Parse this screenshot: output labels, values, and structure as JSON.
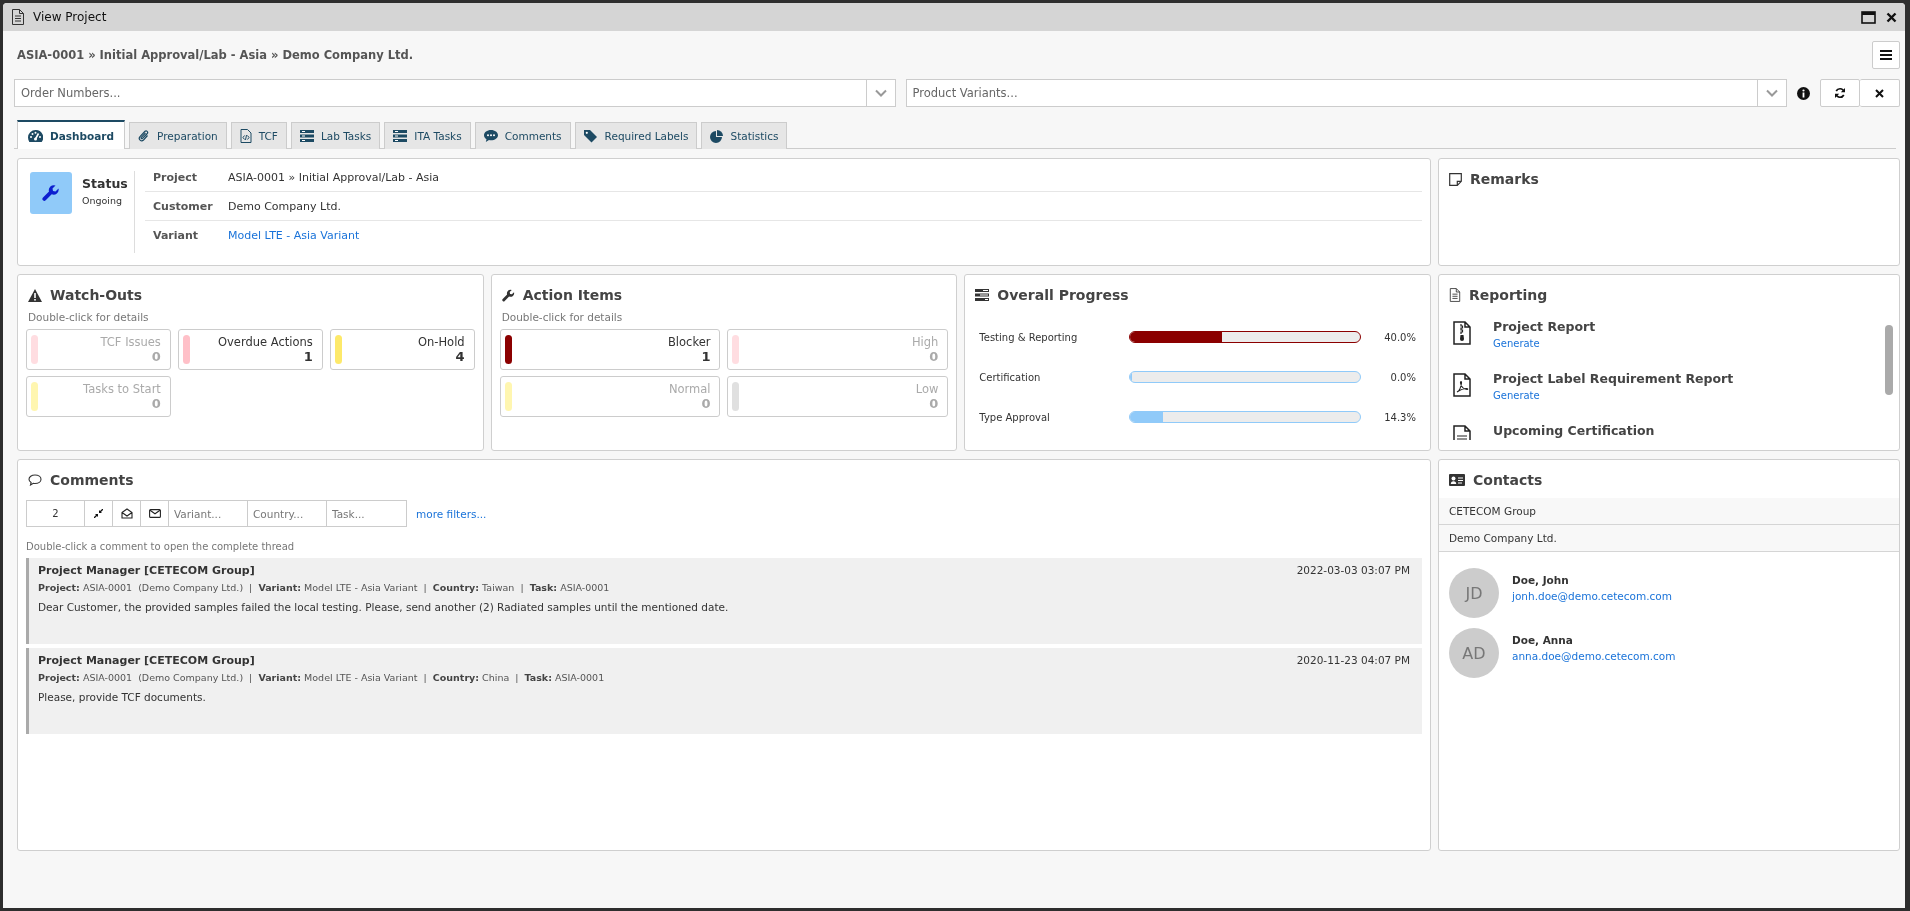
{
  "window": {
    "title": "View Project"
  },
  "breadcrumb": "ASIA-0001 » Initial Approval/Lab - Asia » Demo Company Ltd.",
  "filters": {
    "order_numbers": {
      "placeholder": "Order Numbers..."
    },
    "product_variants": {
      "placeholder": "Product Variants..."
    }
  },
  "tabs": [
    {
      "label": "Dashboard",
      "kind": "dashboard",
      "selected": true
    },
    {
      "label": "Preparation",
      "kind": "paperclip",
      "selected": false
    },
    {
      "label": "TCF",
      "kind": "code-file",
      "selected": false
    },
    {
      "label": "Lab Tasks",
      "kind": "tasks",
      "selected": false
    },
    {
      "label": "ITA Tasks",
      "kind": "tasks",
      "selected": false
    },
    {
      "label": "Comments",
      "kind": "chat",
      "selected": false
    },
    {
      "label": "Required Labels",
      "kind": "tags",
      "selected": false
    },
    {
      "label": "Statistics",
      "kind": "pie",
      "selected": false
    }
  ],
  "status": {
    "label": "Status",
    "value": "Ongoing",
    "rows": [
      {
        "label": "Project",
        "value": "ASIA-0001 » Initial Approval/Lab - Asia",
        "kind": "text"
      },
      {
        "label": "Customer",
        "value": "Demo Company Ltd.",
        "kind": "text"
      },
      {
        "label": "Variant",
        "value": "Model LTE - Asia Variant",
        "kind": "link"
      }
    ]
  },
  "remarks": {
    "title": "Remarks"
  },
  "watch_outs": {
    "title": "Watch-Outs",
    "hint": "Double-click for details",
    "tiles": [
      {
        "label": "TCF Issues",
        "count": "0",
        "color": "#ffdde1",
        "active": false
      },
      {
        "label": "Overdue Actions",
        "count": "1",
        "color": "#ffc0c8",
        "active": true
      },
      {
        "label": "On-Hold",
        "count": "4",
        "color": "#fde96a",
        "active": true
      },
      {
        "label": "Tasks to Start",
        "count": "0",
        "color": "#fff6b0",
        "active": false
      }
    ]
  },
  "action_items": {
    "title": "Action Items",
    "hint": "Double-click for details",
    "tiles": [
      {
        "label": "Blocker",
        "count": "1",
        "color": "#8b0000",
        "active": true
      },
      {
        "label": "High",
        "count": "0",
        "color": "#ffdde1",
        "active": false
      },
      {
        "label": "Normal",
        "count": "0",
        "color": "#fff6b0",
        "active": false
      },
      {
        "label": "Low",
        "count": "0",
        "color": "#e0e0e0",
        "active": false
      }
    ]
  },
  "overall_progress": {
    "title": "Overall Progress",
    "items": [
      {
        "label": "Testing & Reporting",
        "level": 0.4,
        "reading": "40.0%",
        "color": "#8b0000"
      },
      {
        "label": "Certification",
        "level": 0,
        "reading": "0.0%",
        "color": "#90caf9"
      },
      {
        "label": "Type Approval",
        "level": 0.143,
        "reading": "14.3%",
        "color": "#90caf9"
      }
    ]
  },
  "reporting": {
    "title": "Reporting",
    "items": [
      {
        "kind": "zip",
        "title": "Project Report",
        "action": "Generate"
      },
      {
        "kind": "pdf",
        "title": "Project Label Requirement Report",
        "action": "Generate"
      },
      {
        "kind": "doc",
        "title": "Upcoming Certification"
      }
    ]
  },
  "comments": {
    "title": "Comments",
    "filter": {
      "count": "2",
      "variant": {
        "placeholder": "Variant..."
      },
      "country": {
        "placeholder": "Country..."
      },
      "task": {
        "placeholder": "Task..."
      },
      "more": "more filters..."
    },
    "hint": "Double-click a comment to open the complete thread",
    "items": [
      {
        "author": "Project Manager [CETECOM Group]",
        "date": "2022-03-03 03:07 PM",
        "meta": "**Project:** ASIA-0001  (Demo Company Ltd.)  |  **Variant:** Model LTE - Asia Variant  |  **Country:** Taiwan  |  **Task:** ASIA-0001",
        "text": "Dear Customer, the provided samples failed the local testing. Please, send another (2) Radiated samples until the mentioned date."
      },
      {
        "author": "Project Manager [CETECOM Group]",
        "date": "2020-11-23 04:07 PM",
        "meta": "**Project:** ASIA-0001  (Demo Company Ltd.)  |  **Variant:** Model LTE - Asia Variant  |  **Country:** China  |  **Task:** ASIA-0001",
        "text": "Please, provide TCF documents."
      }
    ]
  },
  "contacts": {
    "title": "Contacts",
    "groups": [
      "CETECOM Group",
      "Demo Company Ltd."
    ],
    "people": [
      {
        "initials": "JD",
        "name": "Doe, John",
        "email": "jonh.doe@demo.cetecom.com"
      },
      {
        "initials": "AD",
        "name": "Doe, Anna",
        "email": "anna.doe@demo.cetecom.com"
      }
    ]
  }
}
